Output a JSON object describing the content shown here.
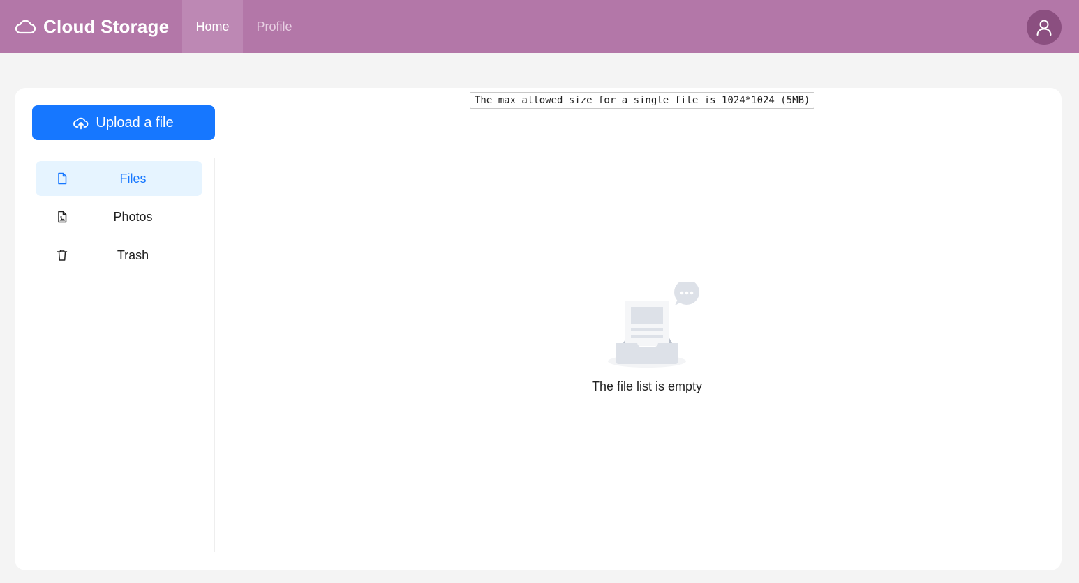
{
  "app": {
    "title": "Cloud Storage",
    "brand_icon": "cloud-icon"
  },
  "nav": {
    "tabs": [
      {
        "label": "Home",
        "active": true
      },
      {
        "label": "Profile",
        "active": false
      }
    ],
    "avatar_icon": "user-icon"
  },
  "upload": {
    "label": "Upload a file",
    "icon": "cloud-upload-icon"
  },
  "sidebar": {
    "items": [
      {
        "label": "Files",
        "icon": "file-icon",
        "active": true
      },
      {
        "label": "Photos",
        "icon": "file-image-icon",
        "active": false
      },
      {
        "label": "Trash",
        "icon": "trash-icon",
        "active": false
      }
    ]
  },
  "notice": {
    "text": "The max allowed size for a single file is 1024*1024 (5MB)"
  },
  "empty_state": {
    "text": "The file list is empty",
    "icon": "empty-inbox-icon"
  },
  "colors": {
    "header": "#b377a8",
    "primary": "#1677ff",
    "active_bg": "#e6f4ff",
    "avatar_bg": "#8b4f80",
    "page_bg": "#f4f4f4"
  }
}
